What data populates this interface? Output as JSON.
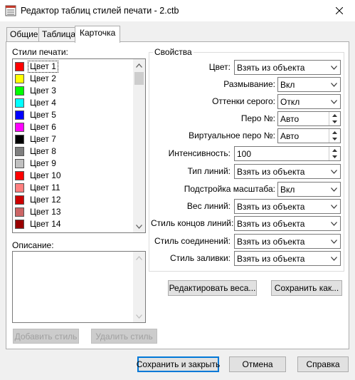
{
  "window": {
    "title": "Редактор таблиц стилей печати - 2.ctb"
  },
  "tabs": [
    "Общие",
    "Таблица",
    "Карточка"
  ],
  "styles": {
    "label": "Стили печати:",
    "items": [
      {
        "name": "Цвет 1",
        "color": "#ff0000"
      },
      {
        "name": "Цвет 2",
        "color": "#ffff00"
      },
      {
        "name": "Цвет 3",
        "color": "#00ff00"
      },
      {
        "name": "Цвет 4",
        "color": "#00ffff"
      },
      {
        "name": "Цвет 5",
        "color": "#0000ff"
      },
      {
        "name": "Цвет 6",
        "color": "#ff00ff"
      },
      {
        "name": "Цвет 7",
        "color": "#000000"
      },
      {
        "name": "Цвет 8",
        "color": "#808080"
      },
      {
        "name": "Цвет 9",
        "color": "#c0c0c0"
      },
      {
        "name": "Цвет 10",
        "color": "#ff0000"
      },
      {
        "name": "Цвет 11",
        "color": "#ff7f7f"
      },
      {
        "name": "Цвет 12",
        "color": "#cc0000"
      },
      {
        "name": "Цвет 13",
        "color": "#cc6666"
      },
      {
        "name": "Цвет 14",
        "color": "#990000"
      }
    ]
  },
  "description": {
    "label": "Описание:",
    "value": ""
  },
  "buttons": {
    "add_style": "Добавить стиль",
    "delete_style": "Удалить стиль",
    "edit_weights": "Редактировать веса...",
    "save_as": "Сохранить как...",
    "save_close": "Сохранить и закрыть",
    "cancel": "Отмена",
    "help": "Справка"
  },
  "properties": {
    "group_label": "Свойства",
    "color": {
      "label": "Цвет:",
      "value": "Взять из объекта"
    },
    "dither": {
      "label": "Размывание:",
      "value": "Вкл"
    },
    "grayscale": {
      "label": "Оттенки серого:",
      "value": "Откл"
    },
    "pen": {
      "label": "Перо №:",
      "value": "Авто"
    },
    "virtual_pen": {
      "label": "Виртуальное перо №:",
      "value": "Авто"
    },
    "intensity": {
      "label": "Интенсивность:",
      "value": "100"
    },
    "linetype": {
      "label": "Тип линий:",
      "value": "Взять из объекта"
    },
    "adaptive": {
      "label": "Подстройка масштаба:",
      "value": "Вкл"
    },
    "lineweight": {
      "label": "Вес линий:",
      "value": "Взять из объекта"
    },
    "line_end": {
      "label": "Стиль концов линий:",
      "value": "Взять из объекта"
    },
    "line_join": {
      "label": "Стиль соединений:",
      "value": "Взять из объекта"
    },
    "fill_style": {
      "label": "Стиль заливки:",
      "value": "Взять из объекта"
    }
  }
}
